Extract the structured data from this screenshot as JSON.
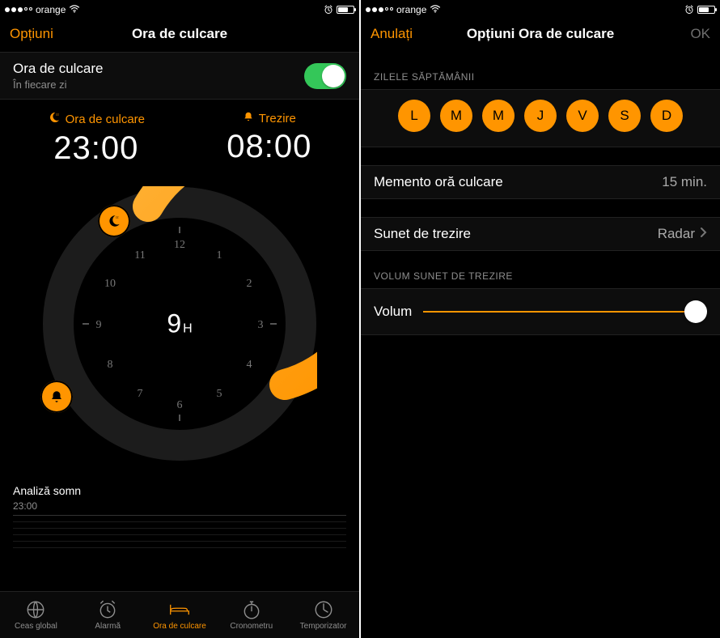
{
  "colors": {
    "accent": "#ff9500",
    "toggle_on": "#34c759"
  },
  "status": {
    "carrier": "orange"
  },
  "left": {
    "nav": {
      "left": "Opțiuni",
      "title": "Ora de culcare"
    },
    "bedtime_row": {
      "title": "Ora de culcare",
      "subtitle": "În fiecare zi"
    },
    "bedtime": {
      "label": "Ora de culcare",
      "time": "23:00"
    },
    "wake": {
      "label": "Trezire",
      "time": "08:00"
    },
    "duration": {
      "hours": "9",
      "unit": "H"
    },
    "analysis": {
      "title": "Analiză somn",
      "axis": "23:00"
    },
    "tabs": [
      {
        "label": "Ceas global"
      },
      {
        "label": "Alarmă"
      },
      {
        "label": "Ora de culcare"
      },
      {
        "label": "Cronometru"
      },
      {
        "label": "Temporizator"
      }
    ]
  },
  "right": {
    "nav": {
      "left": "Anulați",
      "title": "Opțiuni Ora de culcare",
      "right": "OK"
    },
    "days_header": "ZILELE SĂPTĂMÂNII",
    "days": [
      "L",
      "M",
      "M",
      "J",
      "V",
      "S",
      "D"
    ],
    "reminder": {
      "label": "Memento oră culcare",
      "value": "15 min."
    },
    "sound": {
      "label": "Sunet de trezire",
      "value": "Radar"
    },
    "volume_header": "VOLUM SUNET DE TREZIRE",
    "volume": {
      "label": "Volum",
      "percent": 96
    }
  }
}
